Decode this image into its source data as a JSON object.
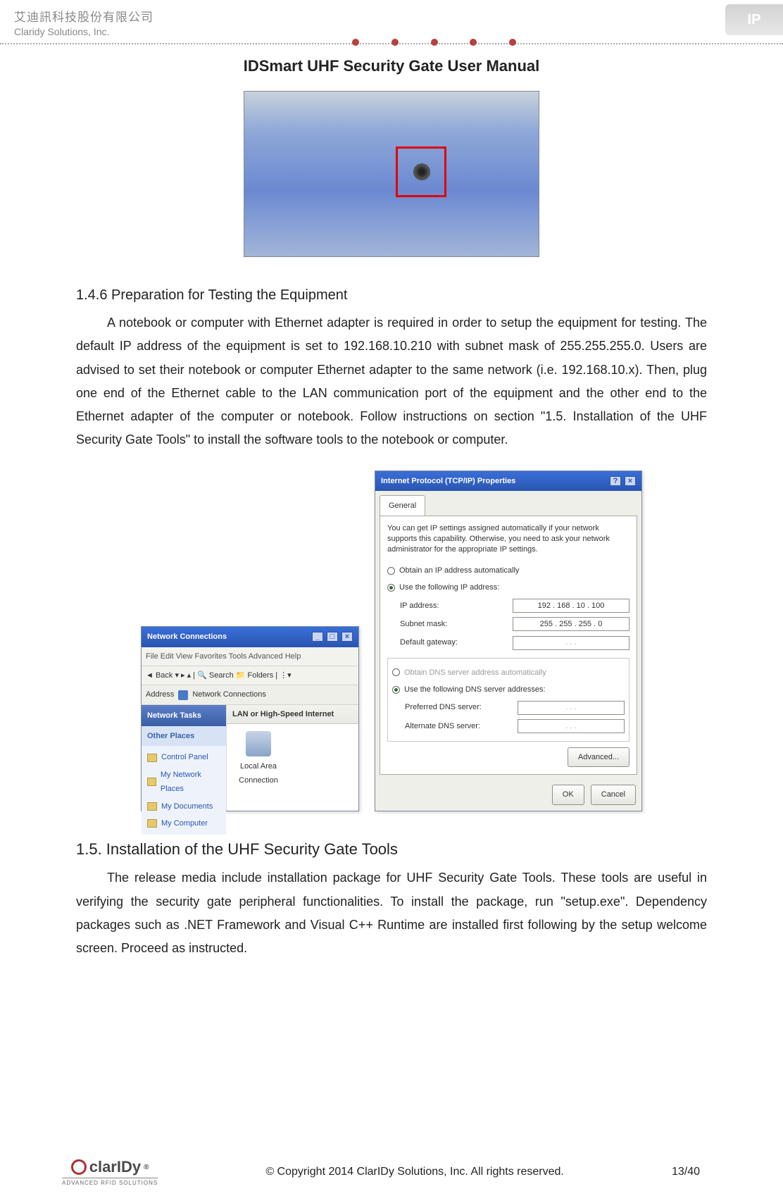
{
  "header": {
    "company_cn": "艾迪訊科技股份有限公司",
    "company_en": "Claridy Solutions, Inc.",
    "ipsmart_logo_text": "IP"
  },
  "title": "IDSmart UHF Security Gate User Manual",
  "section_146": {
    "heading": "1.4.6 Preparation for Testing the Equipment",
    "paragraph": "A notebook or computer with Ethernet adapter is required in order to setup the equipment for testing. The default IP address of the equipment is set to 192.168.10.210 with subnet mask of 255.255.255.0. Users are advised to set their notebook or computer Ethernet adapter to the same network (i.e. 192.168.10.x). Then, plug one end of the Ethernet cable to the LAN communication port of the equipment and the other end to the Ethernet adapter of the computer or notebook. Follow instructions on section \"1.5. Installation of the UHF Security Gate Tools\" to install the software tools to the notebook or computer."
  },
  "win1": {
    "title": "Network Connections",
    "menu": "File   Edit   View   Favorites   Tools   Advanced   Help",
    "toolbar": "◄ Back ▾  ▸  ▴  | 🔍 Search  📁 Folders  | ⋮▾",
    "address_label": "Address",
    "address_value": "Network Connections",
    "tasks_header": "Network Tasks",
    "other_places_header": "Other Places",
    "places": [
      "Control Panel",
      "My Network Places",
      "My Documents",
      "My Computer"
    ],
    "group_header": "LAN or High-Speed Internet",
    "item": "Local Area Connection"
  },
  "win2": {
    "title": "Internet Protocol (TCP/IP) Properties",
    "tab": "General",
    "info": "You can get IP settings assigned automatically if your network supports this capability. Otherwise, you need to ask your network administrator for the appropriate IP settings.",
    "radio_auto_ip": "Obtain an IP address automatically",
    "radio_use_ip": "Use the following IP address:",
    "ip_label": "IP address:",
    "ip_value": "192 . 168 . 10 . 100",
    "subnet_label": "Subnet mask:",
    "subnet_value": "255 . 255 . 255 .  0",
    "gateway_label": "Default gateway:",
    "gateway_value": ".       .       .",
    "radio_auto_dns": "Obtain DNS server address automatically",
    "radio_use_dns": "Use the following DNS server addresses:",
    "pref_dns_label": "Preferred DNS server:",
    "pref_dns_value": ".       .       .",
    "alt_dns_label": "Alternate DNS server:",
    "alt_dns_value": ".       .       .",
    "advanced": "Advanced...",
    "ok": "OK",
    "cancel": "Cancel"
  },
  "section_15": {
    "heading": "1.5. Installation of the UHF Security Gate Tools",
    "paragraph": "The release media include installation package for UHF Security Gate Tools. These tools are useful in verifying the security gate peripheral functionalities. To install the package, run \"setup.exe\".  Dependency packages such as .NET Framework and Visual C++ Runtime are installed first following by the setup welcome screen. Proceed as instructed."
  },
  "footer": {
    "brand": "clarIDy",
    "reg": "®",
    "tagline": "ADVANCED RFID SOLUTIONS",
    "copyright": "© Copyright 2014 ClarIDy Solutions, Inc. All rights reserved.",
    "page": "13/40"
  }
}
